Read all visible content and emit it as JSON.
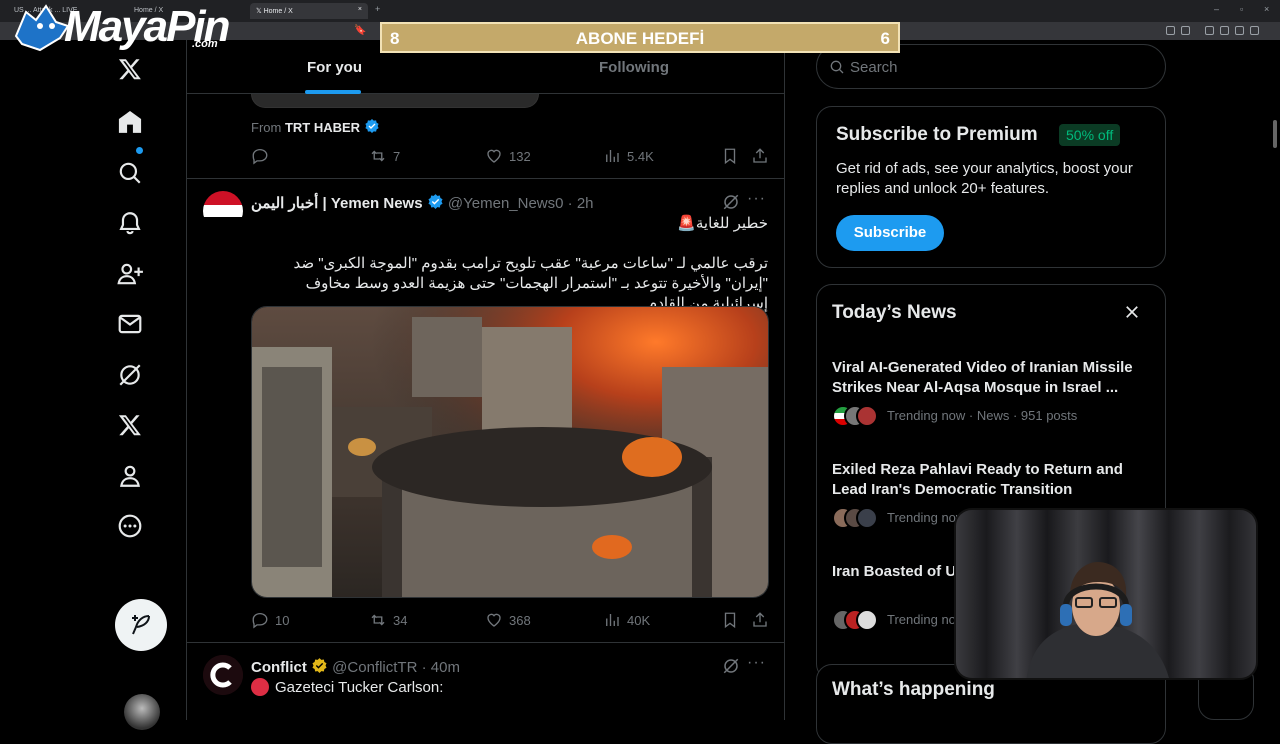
{
  "browser": {
    "tabs": [
      {
        "label": "US ... Attack ... LIVE",
        "active": false
      },
      {
        "label": "Home / X",
        "active": false
      },
      {
        "label": "Home / X",
        "active": true
      }
    ],
    "new_tab": "+"
  },
  "overlay": {
    "brand": "MayaPin",
    "brand_suffix": ".com",
    "goal_label": "ABONE HEDEFİ",
    "goal_left": "8",
    "goal_right": "6"
  },
  "nav": {
    "items": [
      "x-logo",
      "home",
      "explore",
      "notifications",
      "follow",
      "messages",
      "grok",
      "premium",
      "profile",
      "more"
    ],
    "post_icon": "feather-plus-icon"
  },
  "feed": {
    "tabs": [
      {
        "label": "For you",
        "selected": true
      },
      {
        "label": "Following",
        "selected": false
      }
    ],
    "prev_tweet": {
      "from_prefix": "From",
      "from_name": "TRT HABER",
      "replies": "",
      "reposts": "7",
      "likes": "132",
      "views": "5.4K"
    },
    "tweet": {
      "name": "أخبار اليمن | Yemen News",
      "handle": "@Yemen_News0",
      "time": "· 2h",
      "headline": "خطير للغاية🚨",
      "body": "ترقب عالمي لـ \"ساعات مرعبة\" عقب تلويح ترامب بقدوم \"الموجة الكبرى\" ضد \"إيران\" والأخيرة تتوعد بـ \"استمرار الهجمات\" حتى هزيمة العدو وسط مخاوف إسرائيلية من القادم",
      "replies": "10",
      "reposts": "34",
      "likes": "368",
      "views": "40K"
    },
    "next_tweet": {
      "name": "Conflict",
      "handle": "@ConflictTR",
      "time": "· 40m",
      "text": "Gazeteci Tucker Carlson:"
    }
  },
  "sidebar": {
    "search_placeholder": "Search",
    "premium": {
      "title": "Subscribe to Premium",
      "badge": "50% off",
      "body": "Get rid of ads, see your analytics, boost your replies and unlock 20+ features.",
      "button": "Subscribe"
    },
    "news": {
      "title": "Today’s News",
      "items": [
        {
          "headline": "Viral AI-Generated Video of Iranian Missile Strikes Near Al-Aqsa Mosque in Israel ...",
          "meta": "Trending now · News · 951 posts"
        },
        {
          "headline": "Exiled Reza Pahlavi Ready to Return and Lead Iran's Democratic Transition",
          "meta": "Trending now"
        },
        {
          "headline": "Iran Boasted of U... Nuclear Talks, U...",
          "meta": "Trending no"
        }
      ]
    },
    "happening_title": "What’s happening"
  },
  "colors": {
    "accent": "#1d9bf0",
    "verified": "#1d9bf0",
    "gold": "#c4a96a",
    "premium_badge": "#00ba7c"
  }
}
